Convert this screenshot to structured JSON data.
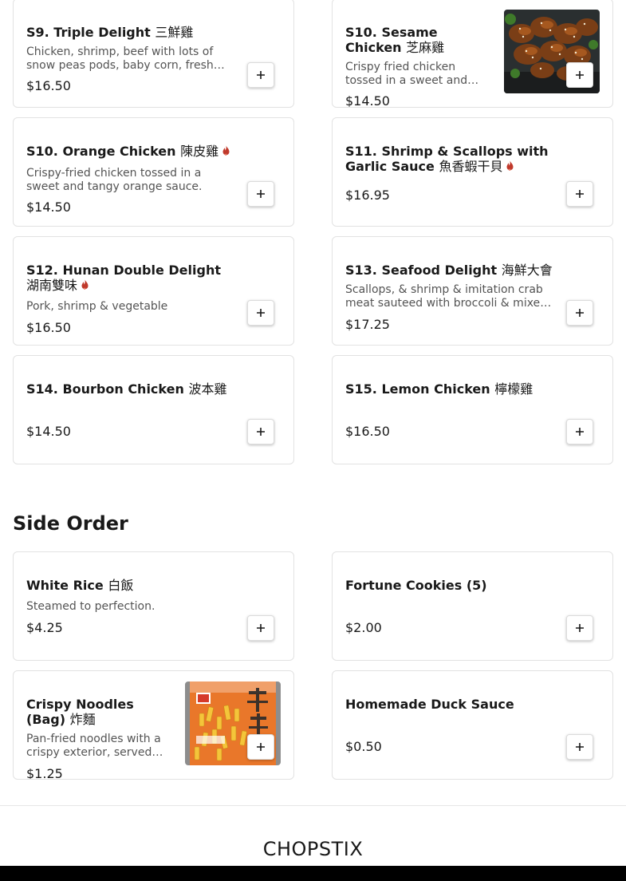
{
  "colors": {
    "accent_spicy": "#c0392b",
    "text": "#191919",
    "muted": "#545454",
    "border": "#e2e2e2"
  },
  "icons": {
    "spicy": "flame-icon",
    "add": "plus-icon"
  },
  "menu_items": [
    {
      "name": "S9. Triple Delight",
      "cjk": "三鮮雞",
      "spicy": false,
      "desc": "Chicken, shrimp, beef with lots of snow peas pods, baby corn, fresh mushrooms and vegetables.",
      "price": "$16.50",
      "add_label": "+"
    },
    {
      "name": "S10. Sesame Chicken",
      "cjk": "芝麻雞",
      "spicy": false,
      "desc": "Crispy fried chicken tossed in a sweet and savory sesame sauce.",
      "price": "$14.50",
      "image": "sesame-chicken-photo",
      "add_label": "+"
    },
    {
      "name": "S10. Orange Chicken",
      "cjk": "陳皮雞",
      "spicy": true,
      "desc": "Crispy-fried chicken tossed in a sweet and tangy orange sauce.",
      "price": "$14.50",
      "add_label": "+"
    },
    {
      "name": "S11. Shrimp & Scallops with Garlic Sauce",
      "cjk": "魚香蝦干貝",
      "spicy": true,
      "desc": "",
      "price": "$16.95",
      "add_label": "+"
    },
    {
      "name": "S12. Hunan Double Delight",
      "cjk": "湖南雙味",
      "spicy": true,
      "desc": "Pork, shrimp & vegetable",
      "price": "$16.50",
      "add_label": "+"
    },
    {
      "name": "S13. Seafood Delight",
      "cjk": "海鮮大會",
      "spicy": false,
      "desc": "Scallops, & shrimp & imitation crab meat sauteed with broccoli & mixed vegetables.",
      "price": "$17.25",
      "add_label": "+"
    },
    {
      "name": "S14. Bourbon Chicken",
      "cjk": "波本雞",
      "spicy": false,
      "desc": "",
      "price": "$14.50",
      "add_label": "+"
    },
    {
      "name": "S15. Lemon Chicken",
      "cjk": "檸檬雞",
      "spicy": false,
      "desc": "",
      "price": "$16.50",
      "add_label": "+"
    }
  ],
  "side_order": {
    "title": "Side Order",
    "items": [
      {
        "name": "White Rice",
        "cjk": "白飯",
        "desc": "Steamed to perfection.",
        "price": "$4.25",
        "add_label": "+"
      },
      {
        "name": "Fortune Cookies (5)",
        "cjk": "",
        "desc": "",
        "price": "$2.00",
        "add_label": "+"
      },
      {
        "name": "Crispy Noodles (Bag)",
        "cjk": "炸麵",
        "desc": "Pan-fried noodles with a crispy exterior, served with duck sauce.",
        "price": "$1.25",
        "image": "crispy-noodles-bag-photo",
        "add_label": "+"
      },
      {
        "name": "Homemade Duck Sauce",
        "cjk": "",
        "desc": "",
        "price": "$0.50",
        "add_label": "+"
      }
    ]
  },
  "footer": {
    "brand": "CHOPSTIX"
  }
}
